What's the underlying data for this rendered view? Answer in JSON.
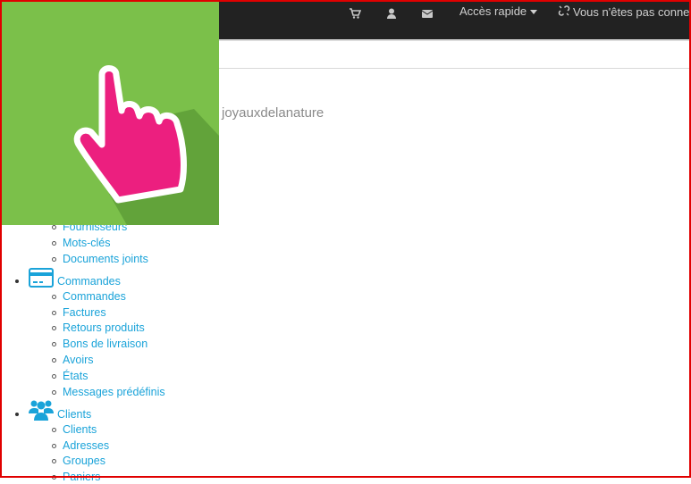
{
  "header": {
    "quick_access_label": "Accès rapide",
    "maintenance_label": "Vous n'êtes pas connect",
    "icons": [
      "cart-icon",
      "user-icon",
      "envelope-icon",
      "caret-down-icon",
      "unlink-icon"
    ]
  },
  "shop": {
    "name": "joyauxdelanature"
  },
  "overlay": {
    "icon": "pointing-hand-icon",
    "background": "#7bc04a",
    "hand_color": "#ec1f7f"
  },
  "menu": {
    "catalog_tail": [
      "Fournisseurs",
      "Mots-clés",
      "Documents joints"
    ],
    "orders": {
      "label": "Commandes",
      "icon": "credit-card-icon",
      "items": [
        "Commandes",
        "Factures",
        "Retours produits",
        "Bons de livraison",
        "Avoirs",
        "États",
        "Messages prédéfinis"
      ]
    },
    "customers": {
      "label": "Clients",
      "icon": "users-icon",
      "items": [
        "Clients",
        "Adresses",
        "Groupes",
        "Paniers"
      ]
    }
  },
  "colors": {
    "topbar": "#222222",
    "link": "#1aa3d9",
    "frame": "#e00000"
  }
}
